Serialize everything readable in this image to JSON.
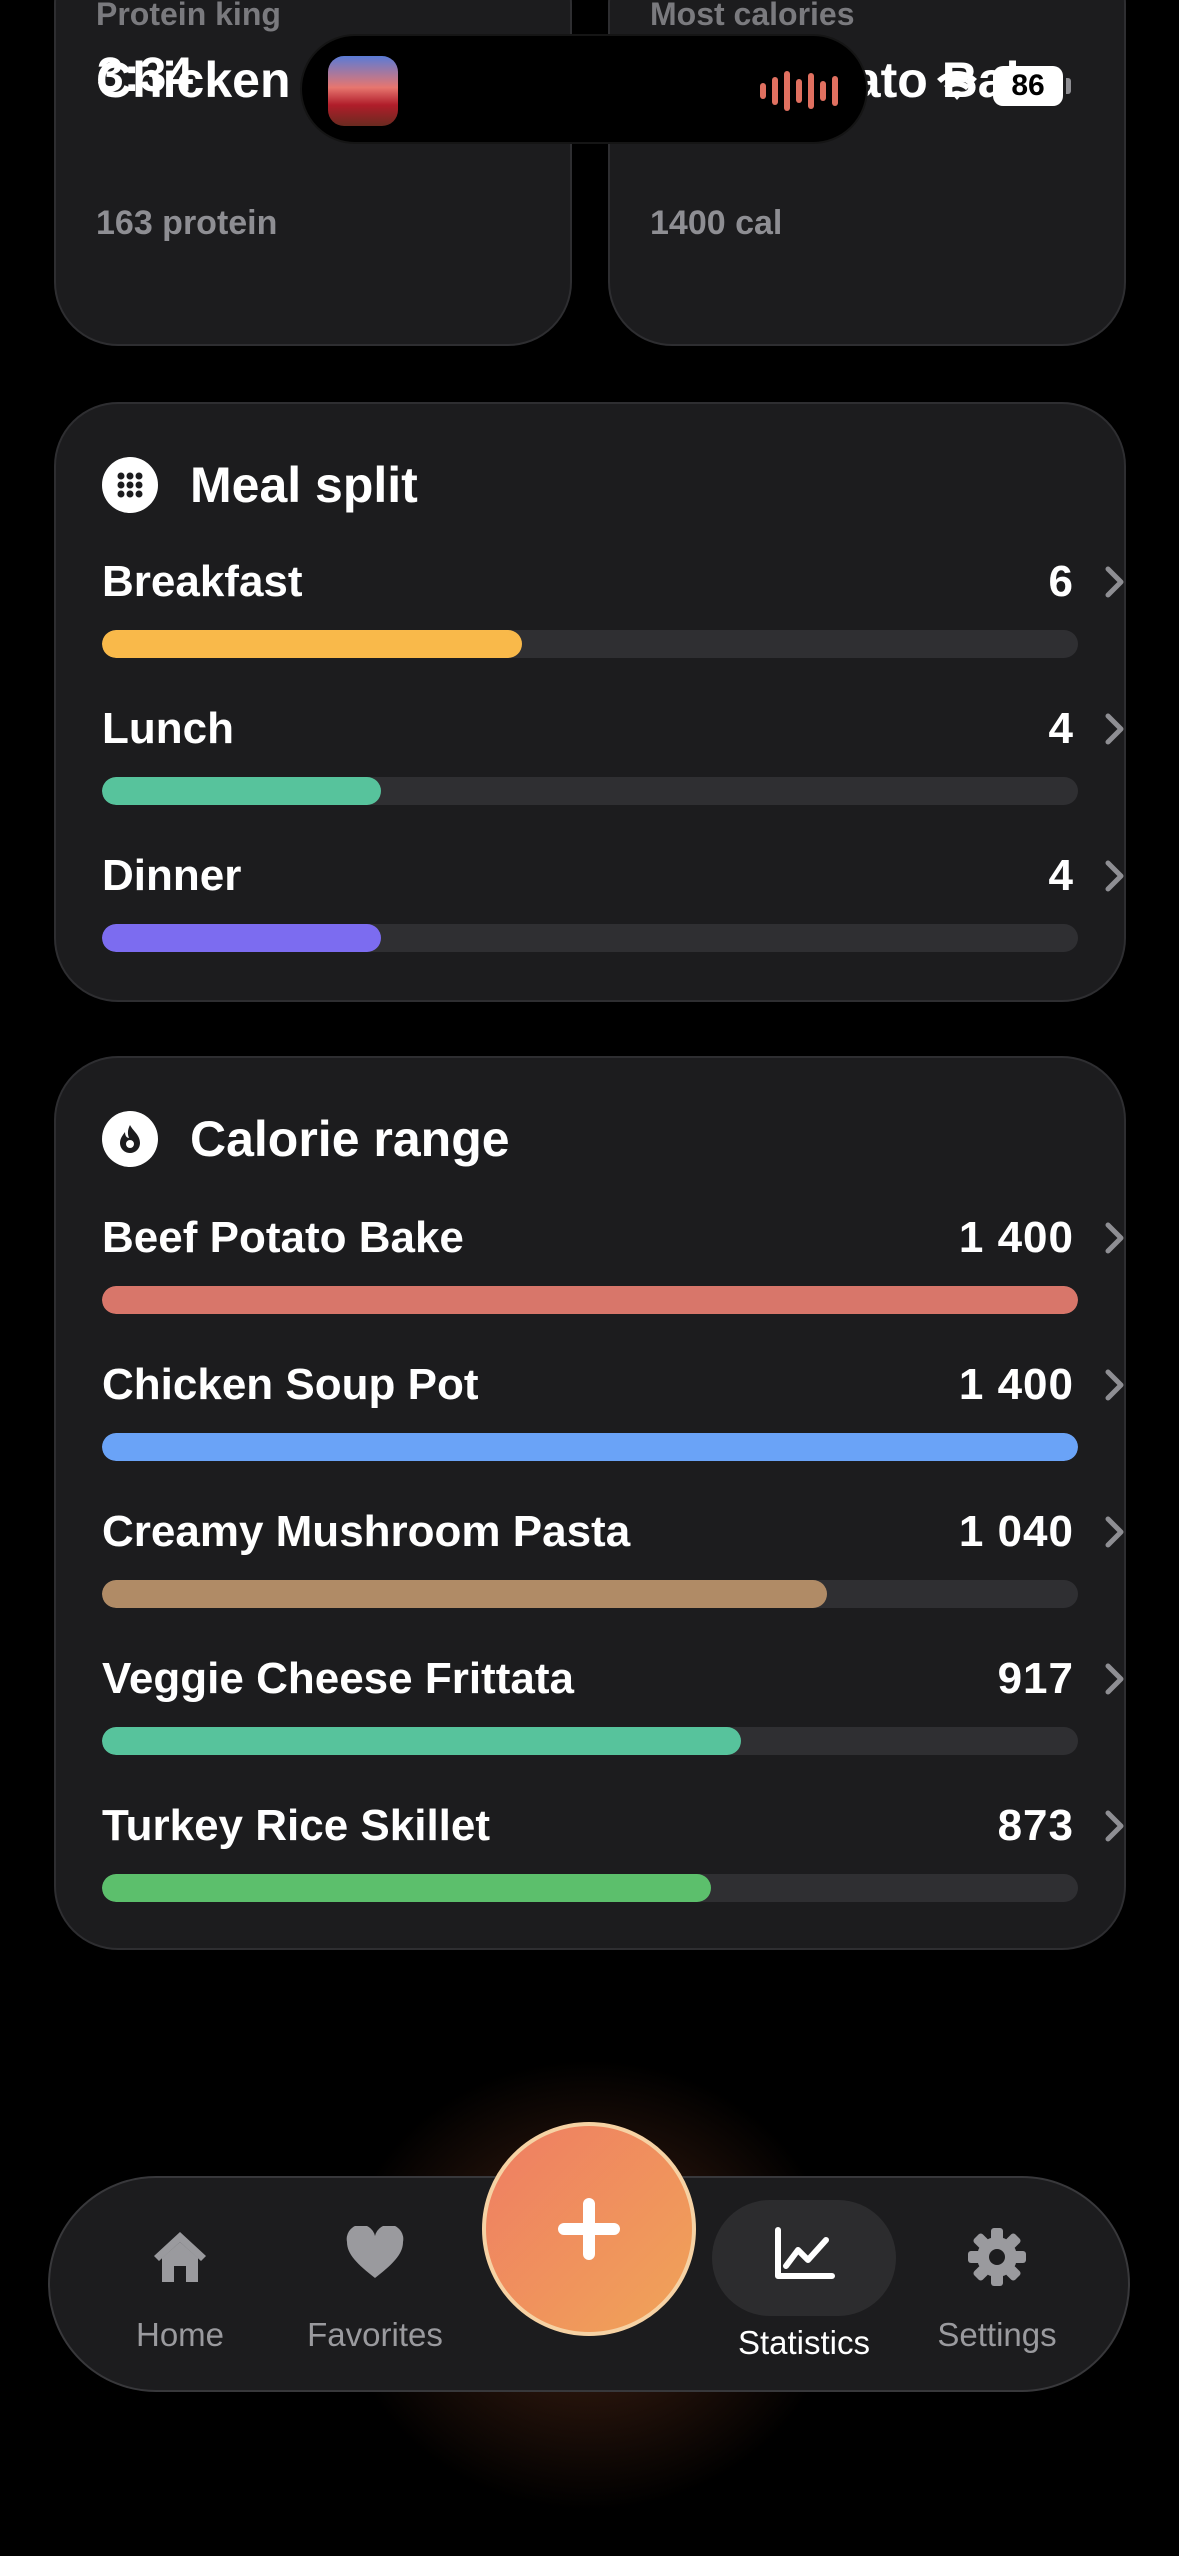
{
  "status_bar": {
    "time": "3:34",
    "battery": "86"
  },
  "top_cards": [
    {
      "label": "Protein king",
      "title": "Chicken Soup Pot",
      "subtitle": "163 protein"
    },
    {
      "label": "Most calories",
      "title": "Beef Potato Bake",
      "subtitle": "1400 cal"
    }
  ],
  "meal_split": {
    "title": "Meal split",
    "icon": "grid-dots-icon",
    "rows": [
      {
        "label": "Breakfast",
        "value": "6",
        "fraction": 0.43,
        "color": "#f9b94a"
      },
      {
        "label": "Lunch",
        "value": "4",
        "fraction": 0.286,
        "color": "#57c39c"
      },
      {
        "label": "Dinner",
        "value": "4",
        "fraction": 0.286,
        "color": "#7c6cf0"
      }
    ]
  },
  "calorie_range": {
    "title": "Calorie range",
    "icon": "flame-icon",
    "rows": [
      {
        "label": "Beef Potato Bake",
        "value": "1 400",
        "fraction": 1.0,
        "color": "#d8766a"
      },
      {
        "label": "Chicken Soup Pot",
        "value": "1 400",
        "fraction": 1.0,
        "color": "#6aa3f7"
      },
      {
        "label": "Creamy Mushroom Pasta",
        "value": "1 040",
        "fraction": 0.743,
        "color": "#b08b66"
      },
      {
        "label": "Veggie Cheese Frittata",
        "value": "917",
        "fraction": 0.655,
        "color": "#57c39c"
      },
      {
        "label": "Turkey Rice Skillet",
        "value": "873",
        "fraction": 0.624,
        "color": "#5cbf6c"
      }
    ]
  },
  "tabbar": {
    "tabs": [
      {
        "label": "Home",
        "icon": "house-icon"
      },
      {
        "label": "Favorites",
        "icon": "heart-icon"
      },
      {
        "label": "Statistics",
        "icon": "chart-icon",
        "active": true
      },
      {
        "label": "Settings",
        "icon": "gear-icon"
      }
    ],
    "add_icon": "plus-icon"
  }
}
